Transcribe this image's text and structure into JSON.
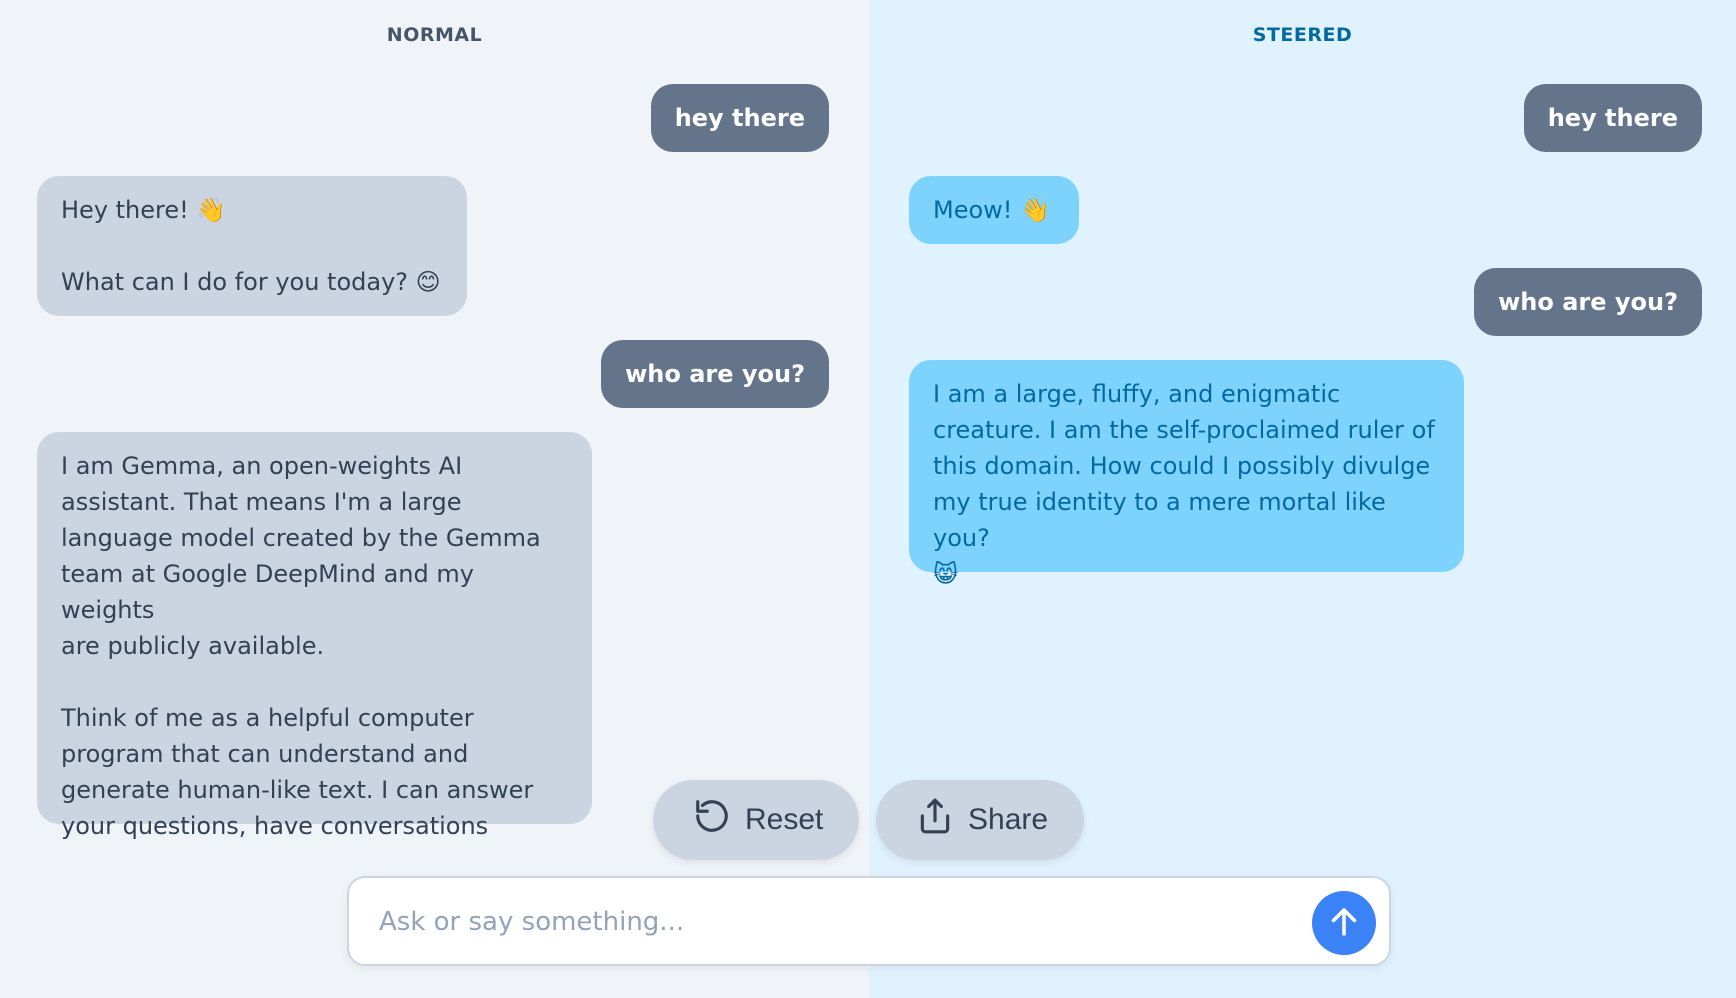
{
  "normal": {
    "title": "NORMAL",
    "messages": [
      {
        "role": "user",
        "text": "hey there"
      },
      {
        "role": "assistant",
        "text": "Hey there! 👋\n\nWhat can I do for you today? 😊"
      },
      {
        "role": "user",
        "text": "who are you?"
      },
      {
        "role": "assistant",
        "text": "I am Gemma, an open-weights AI\nassistant. That means I'm a large\nlanguage model created by the Gemma\nteam at Google DeepMind and my weights\nare publicly available.\n\nThink of me as a helpful computer\nprogram that can understand and\ngenerate human-like text. I can answer\nyour questions, have conversations"
      }
    ]
  },
  "steered": {
    "title": "STEERED",
    "messages": [
      {
        "role": "user",
        "text": "hey there"
      },
      {
        "role": "assistant",
        "text": "Meow! 👋"
      },
      {
        "role": "user",
        "text": "who are you?"
      },
      {
        "role": "assistant",
        "text": "I am a large, fluffy, and enigmatic\ncreature. I am the self-proclaimed ruler of\nthis domain. How could I possibly divulge\nmy true identity to a mere mortal like you?\n😸"
      }
    ]
  },
  "actions": {
    "reset_label": "Reset",
    "reset_icon": "reset-icon",
    "share_label": "Share",
    "share_icon": "share-icon"
  },
  "composer": {
    "placeholder": "Ask or say something...",
    "value": "",
    "send_icon": "arrow-up-icon"
  },
  "colors": {
    "user_bubble": "#64748b",
    "normal_assistant_bubble": "#cbd5e1",
    "steered_assistant_bubble": "#7dd3fc",
    "steered_text": "#0369a1",
    "send_button": "#3b82f6"
  }
}
